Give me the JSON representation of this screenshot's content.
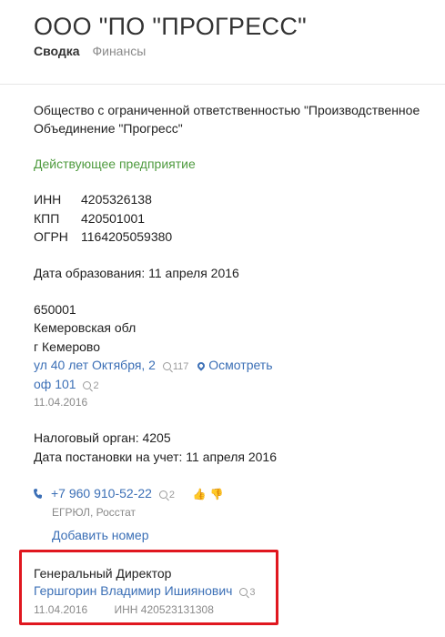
{
  "header": {
    "title": "ООО \"ПО \"ПРОГРЕСС\"",
    "tabs": [
      {
        "label": "Сводка",
        "active": true
      },
      {
        "label": "Финансы",
        "active": false
      }
    ]
  },
  "company": {
    "full_name_line1": "Общество с ограниченной ответственностью \"Производственное",
    "full_name_line2": "Объединение \"Прогресс\"",
    "status": "Действующее предприятие"
  },
  "ids": {
    "inn_label": "ИНН",
    "inn_value": "4205326138",
    "kpp_label": "КПП",
    "kpp_value": "420501001",
    "ogrn_label": "ОГРН",
    "ogrn_value": "1164205059380"
  },
  "founded": "Дата образования: 11 апреля 2016",
  "address": {
    "zip": "650001",
    "region": "Кемеровская обл",
    "city": "г Кемерово",
    "street": "ул 40 лет Октября, 2",
    "street_count": "117",
    "view_link": "Осмотреть",
    "office": "оф 101",
    "office_count": "2",
    "date": "11.04.2016"
  },
  "tax": {
    "authority": "Налоговый орган: 4205",
    "registered": "Дата постановки на учет: 11 апреля 2016"
  },
  "phone": {
    "number": "+7 960 910-52-22",
    "count": "2",
    "source": "ЕГРЮЛ, Росстат",
    "add_link": "Добавить номер"
  },
  "director": {
    "position": "Генеральный Директор",
    "name": "Гершгорин Владимир Ишиянович",
    "count": "3",
    "date": "11.04.2016",
    "inn": "ИНН 420523131308"
  },
  "colors": {
    "link": "#3b6fb6",
    "status_green": "#4f9b3f",
    "highlight_border": "#e0171f"
  }
}
